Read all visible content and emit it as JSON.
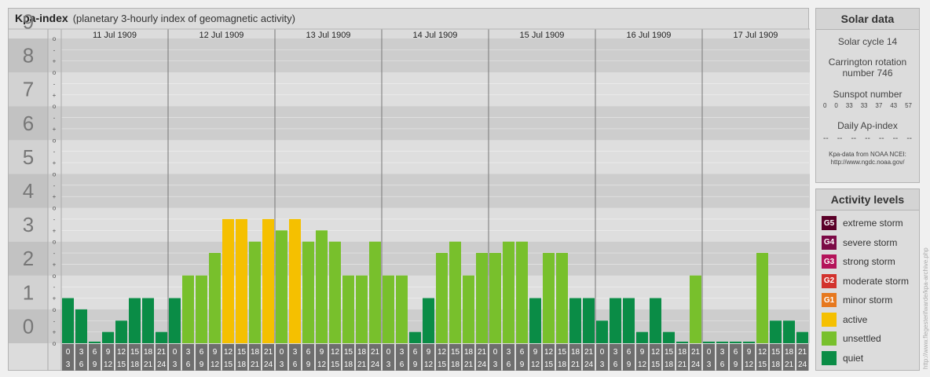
{
  "title": {
    "main": "Kpa-index",
    "sub": "(planetary 3-hourly index of geomagnetic activity)"
  },
  "chart_data": {
    "type": "bar",
    "title": "Kpa-index",
    "subtitle": "(planetary 3-hourly index of geomagnetic activity)",
    "ylim": [
      0,
      9
    ],
    "y_tick_labels": [
      "0",
      "1",
      "2",
      "3",
      "4",
      "5",
      "6",
      "7",
      "8",
      "9"
    ],
    "minor_tick_labels": [
      "-",
      "o",
      "+"
    ],
    "days": [
      "11 Jul 1909",
      "12 Jul 1909",
      "13 Jul 1909",
      "14 Jul 1909",
      "15 Jul 1909",
      "16 Jul 1909",
      "17 Jul 1909"
    ],
    "interval_start_labels": [
      "0",
      "3",
      "6",
      "9",
      "12",
      "15",
      "18",
      "21"
    ],
    "interval_end_labels": [
      "3",
      "6",
      "9",
      "12",
      "15",
      "18",
      "21",
      "24"
    ],
    "values": [
      1.333,
      1.0,
      0.0,
      0.333,
      0.667,
      1.333,
      1.333,
      0.333,
      1.333,
      2.0,
      2.0,
      2.667,
      3.667,
      3.667,
      3.0,
      3.667,
      3.333,
      3.667,
      3.0,
      3.333,
      3.0,
      2.0,
      2.0,
      3.0,
      2.0,
      2.0,
      0.333,
      1.333,
      2.667,
      3.0,
      2.0,
      2.667,
      2.667,
      3.0,
      3.0,
      1.333,
      2.667,
      2.667,
      1.333,
      1.333,
      0.667,
      1.333,
      1.333,
      0.333,
      1.333,
      0.333,
      0.0,
      2.0,
      0.0,
      0.0,
      0.0,
      0.0,
      2.667,
      0.667,
      0.667,
      0.333
    ],
    "grid": true
  },
  "solar": {
    "title": "Solar data",
    "cycle": "Solar cycle 14",
    "carrington_line1": "Carrington rotation",
    "carrington_line2": "number 746",
    "sunspot_title": "Sunspot number",
    "sunspot_values": [
      "0",
      "0",
      "33",
      "33",
      "37",
      "43",
      "57"
    ],
    "ap_title": "Daily Ap-index",
    "ap_values": [
      "--",
      "--",
      "--",
      "--",
      "--",
      "--",
      "--"
    ],
    "source_line1": "Kpa-data from NOAA NCEI:",
    "source_line2": "http://www.ngdc.noaa.gov/"
  },
  "activity": {
    "title": "Activity levels",
    "levels": [
      {
        "badge": "G5",
        "label": "extreme storm",
        "color": "#5a0028"
      },
      {
        "badge": "G4",
        "label": "severe storm",
        "color": "#7b0a46"
      },
      {
        "badge": "G3",
        "label": "strong storm",
        "color": "#b4145a"
      },
      {
        "badge": "G2",
        "label": "moderate storm",
        "color": "#d2322d"
      },
      {
        "badge": "G1",
        "label": "minor storm",
        "color": "#e6781e"
      },
      {
        "badge": "",
        "label": "active",
        "color": "#f5c000"
      },
      {
        "badge": "",
        "label": "unsettled",
        "color": "#78c02c"
      },
      {
        "badge": "",
        "label": "quiet",
        "color": "#0a8c46"
      }
    ]
  },
  "colors": {
    "quiet": "#0a8c46",
    "unsettled": "#78c02c",
    "active": "#f5c000"
  },
  "watermark": "http://www.flegesterifwarde/kpa-archive.php"
}
